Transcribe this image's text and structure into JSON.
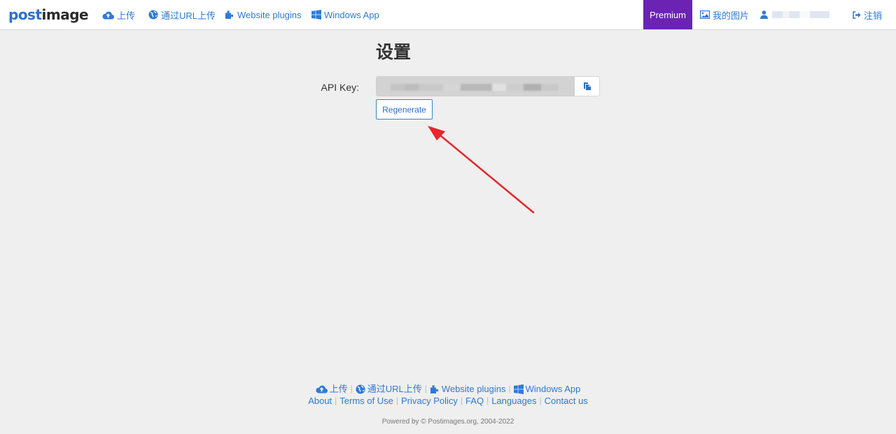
{
  "brand": {
    "part1": "post",
    "part2": "image"
  },
  "nav": {
    "upload": "上传",
    "url_upload": "通过URL上传",
    "website_plugins": "Website plugins",
    "windows_app": "Windows App",
    "premium": "Premium",
    "my_images": "我的图片",
    "logout": "注销"
  },
  "settings": {
    "title": "设置",
    "api_key_label": "API Key:",
    "regenerate_label": "Regenerate"
  },
  "footer": {
    "row1": [
      "上传",
      "通过URL上传",
      "Website plugins",
      "Windows App"
    ],
    "row2": [
      "About",
      "Terms of Use",
      "Privacy Policy",
      "FAQ",
      "Languages",
      "Contact us"
    ],
    "powered": "Powered by © Postimages.org, 2004-2022"
  },
  "colors": {
    "link": "#2d7ad9",
    "premium_bg": "#6b23b3",
    "background": "#efefef",
    "annotation": "#e8262b"
  },
  "icons": {
    "upload": "cloud-upload-icon",
    "url": "globe-icon",
    "plugins": "puzzle-icon",
    "windows": "windows-icon",
    "images": "image-icon",
    "user": "user-icon",
    "logout": "sign-out-icon",
    "copy": "copy-icon"
  }
}
